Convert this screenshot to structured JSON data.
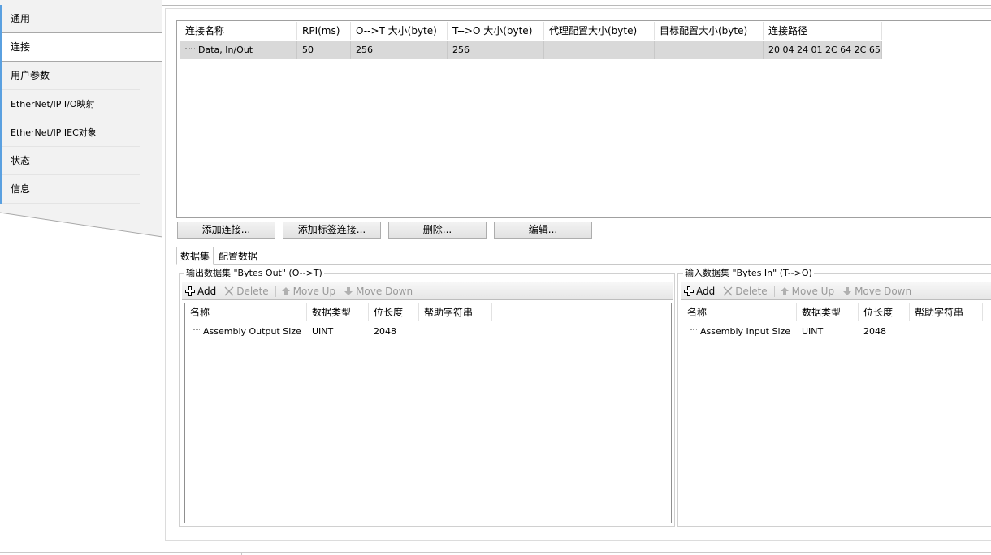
{
  "nav": {
    "items": [
      {
        "label": "通用"
      },
      {
        "label": "连接"
      },
      {
        "label": "用户参数"
      },
      {
        "label": "EtherNet/IP I/O映射"
      },
      {
        "label": "EtherNet/IP IEC对象"
      },
      {
        "label": "状态"
      },
      {
        "label": "信息"
      }
    ],
    "active_index": 1,
    "accent_color": "#5aa0e0"
  },
  "connections": {
    "columns": [
      "连接名称",
      "RPI(ms)",
      "O-->T 大小(byte)",
      "T-->O 大小(byte)",
      "代理配置大小(byte)",
      "目标配置大小(byte)",
      "连接路径"
    ],
    "rows": [
      {
        "name": "Data, In/Out",
        "rpi": "50",
        "ot_size": "256",
        "to_size": "256",
        "proxy_config": "",
        "target_config": "",
        "path": "20 04 24 01 2C 64 2C 65"
      }
    ]
  },
  "buttons": {
    "add_connection": "添加连接...",
    "add_tag_connection": "添加标签连接...",
    "delete": "删除...",
    "edit": "编辑..."
  },
  "tabs": {
    "dataset": "数据集",
    "config_data": "配置数据"
  },
  "output_group": {
    "title": "输出数据集 \"Bytes Out\" (O-->T)",
    "toolbar": {
      "add": "Add",
      "delete": "Delete",
      "move_up": "Move Up",
      "move_down": "Move Down"
    },
    "columns": [
      "名称",
      "数据类型",
      "位长度",
      "帮助字符串"
    ],
    "rows": [
      {
        "name": "Assembly Output Size",
        "type": "UINT",
        "bits": "2048",
        "help": ""
      }
    ]
  },
  "input_group": {
    "title": "输入数据集 \"Bytes In\" (T-->O)",
    "toolbar": {
      "add": "Add",
      "delete": "Delete",
      "move_up": "Move Up",
      "move_down": "Move Down"
    },
    "columns": [
      "名称",
      "数据类型",
      "位长度",
      "帮助字符串"
    ],
    "rows": [
      {
        "name": "Assembly Input Size",
        "type": "UINT",
        "bits": "2048",
        "help": ""
      }
    ]
  },
  "icons": {
    "add": "plus-icon",
    "delete": "x-icon",
    "move_up": "arrow-up-icon",
    "move_down": "arrow-down-icon"
  }
}
